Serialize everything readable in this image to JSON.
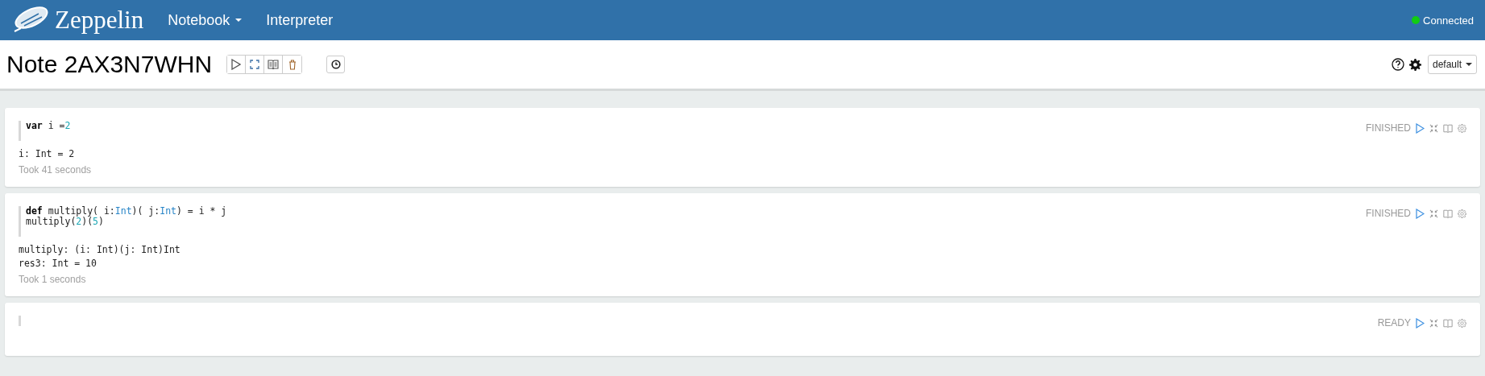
{
  "navbar": {
    "brand": "Zeppelin",
    "menu": [
      {
        "label": "Notebook",
        "dropdown": true
      },
      {
        "label": "Interpreter",
        "dropdown": false
      }
    ],
    "status": {
      "label": "Connected",
      "connected": true
    }
  },
  "note": {
    "title": "Note 2AX3N7WHN",
    "interpreter": "default"
  },
  "paragraphs": [
    {
      "status": "FINISHED",
      "code": [
        [
          {
            "t": "var",
            "kind": "keyword"
          },
          {
            "t": " i =",
            "kind": "plain"
          },
          {
            "t": "2",
            "kind": "number"
          }
        ]
      ],
      "output": [
        "i: Int = 2"
      ],
      "took": "Took 41 seconds"
    },
    {
      "status": "FINISHED",
      "code": [
        [
          {
            "t": "def",
            "kind": "keyword"
          },
          {
            "t": " multiply( i:",
            "kind": "plain"
          },
          {
            "t": "Int",
            "kind": "type"
          },
          {
            "t": ")( j:",
            "kind": "plain"
          },
          {
            "t": "Int",
            "kind": "type"
          },
          {
            "t": ") = i * j",
            "kind": "plain"
          }
        ],
        [
          {
            "t": "multiply(",
            "kind": "plain"
          },
          {
            "t": "2",
            "kind": "number"
          },
          {
            "t": ")(",
            "kind": "plain"
          },
          {
            "t": "5",
            "kind": "number"
          },
          {
            "t": ")",
            "kind": "plain"
          }
        ]
      ],
      "output": [
        "multiply: (i: Int)(j: Int)Int",
        "res3: Int = 10"
      ],
      "took": "Took 1 seconds"
    },
    {
      "status": "READY"
    }
  ]
}
